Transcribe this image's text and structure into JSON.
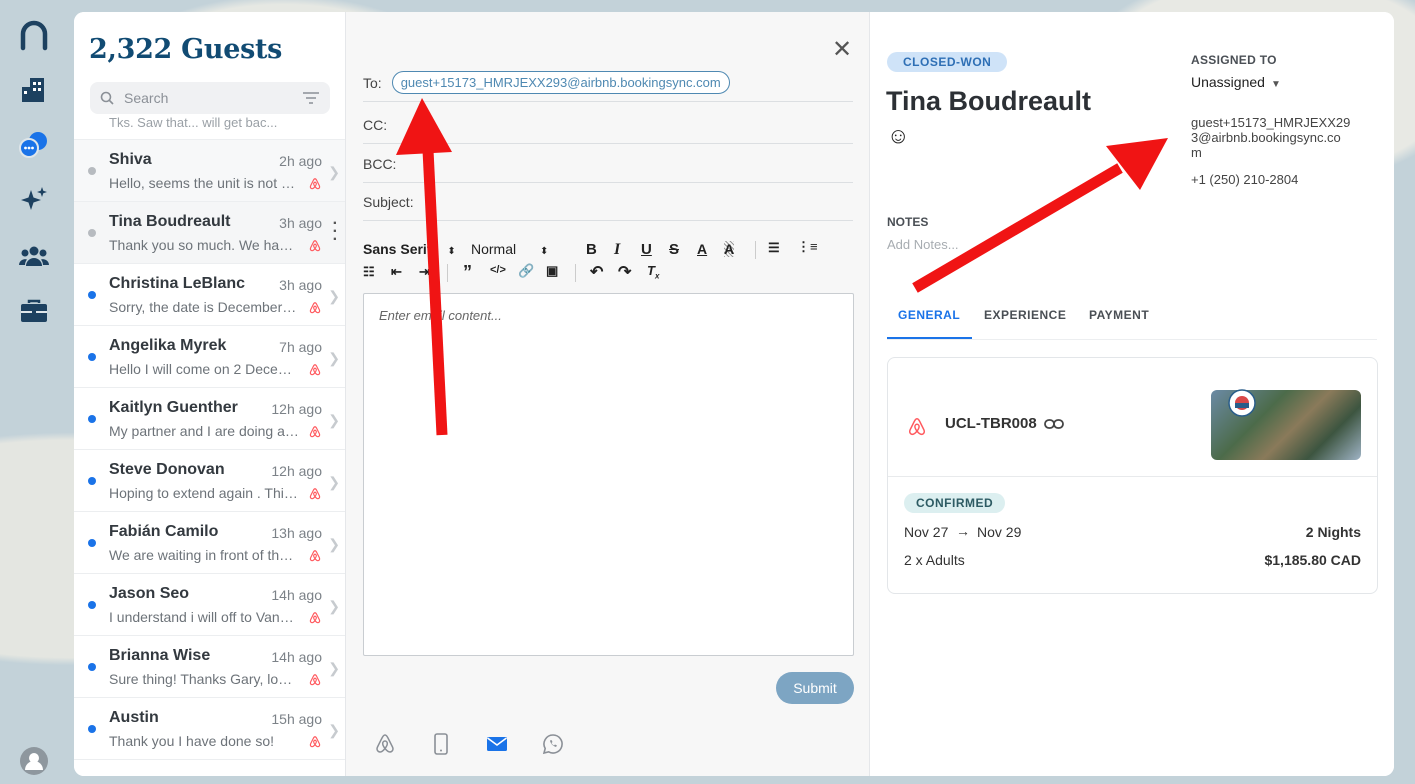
{
  "nav": {
    "items": [
      "logo",
      "properties",
      "messages",
      "ai",
      "guests",
      "work"
    ]
  },
  "list": {
    "title": "2,322 Guests",
    "search_placeholder": "Search",
    "cut_preview": "Tks. Saw that... will get bac...",
    "rows": [
      {
        "name": "Shiva",
        "time": "2h ago",
        "preview": "Hello, seems the unit is not …",
        "read": true
      },
      {
        "name": "Tina Boudreault",
        "time": "3h ago",
        "preview": "Thank you so much. We ha…",
        "read": true
      },
      {
        "name": "Christina LeBlanc",
        "time": "3h ago",
        "preview": "Sorry, the date is December…",
        "read": false
      },
      {
        "name": "Angelika Myrek",
        "time": "7h ago",
        "preview": "Hello I will come on 2 Dece…",
        "read": false
      },
      {
        "name": "Kaitlyn Guenther",
        "time": "12h ago",
        "preview": "My partner and I are doing a…",
        "read": false
      },
      {
        "name": "Steve Donovan",
        "time": "12h ago",
        "preview": "Hoping to extend again . Thi…",
        "read": false
      },
      {
        "name": "Fabián Camilo",
        "time": "13h ago",
        "preview": "We are waiting in front of th…",
        "read": false
      },
      {
        "name": "Jason Seo",
        "time": "14h ago",
        "preview": "I understand i will off to Van…",
        "read": false
      },
      {
        "name": "Brianna Wise",
        "time": "14h ago",
        "preview": "Sure thing! Thanks Gary, lo…",
        "read": false
      },
      {
        "name": "Austin",
        "time": "15h ago",
        "preview": "Thank you I have done so!",
        "read": false
      }
    ]
  },
  "composer": {
    "to_label": "To:",
    "to_value": "guest+15173_HMRJEXX293@airbnb.bookingsync.com",
    "cc_label": "CC:",
    "bcc_label": "BCC:",
    "subject_label": "Subject:",
    "font_select": "Sans Serif",
    "size_select": "Normal",
    "editor_placeholder": "Enter email content...",
    "submit_label": "Submit"
  },
  "details": {
    "status_badge": "CLOSED-WON",
    "guest_name": "Tina Boudreault",
    "mood": "☺",
    "assigned_heading": "ASSIGNED TO",
    "assigned_value": "Unassigned",
    "email": "guest+15173_HMRJEXX293@airbnb.bookingsync.com",
    "phone": "+1 (250) 210-2804",
    "notes_heading": "NOTES",
    "notes_placeholder": "Add Notes...",
    "tabs": [
      "GENERAL",
      "EXPERIENCE",
      "PAYMENT"
    ],
    "booking": {
      "code": "UCL-TBR008",
      "status": "CONFIRMED",
      "check_in": "Nov 27",
      "check_out": "Nov 29",
      "nights": "2 Nights",
      "guests": "2 x Adults",
      "total": "$1,185.80 CAD"
    }
  },
  "colors": {
    "accent": "#1a73e8",
    "brand": "#114b73",
    "airbnb": "#ff5a5f",
    "annotation": "#f01414"
  }
}
